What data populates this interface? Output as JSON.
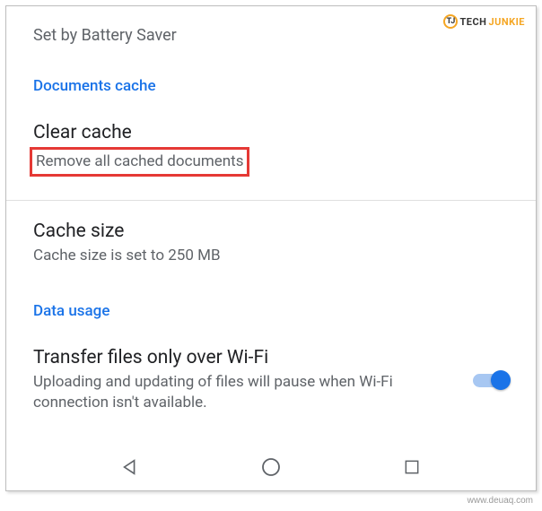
{
  "watermark": {
    "top_tech": "TECH",
    "top_junkie": "JUNKIE",
    "logo_text": "TJ",
    "bottom": "www.deuaq.com"
  },
  "battery_saver": {
    "text": "Set by Battery Saver"
  },
  "sections": {
    "documents_cache": {
      "header": "Documents cache",
      "clear_cache": {
        "title": "Clear cache",
        "subtitle": "Remove all cached documents"
      },
      "cache_size": {
        "title": "Cache size",
        "subtitle": "Cache size is set to 250 MB"
      }
    },
    "data_usage": {
      "header": "Data usage",
      "wifi_only": {
        "title": "Transfer files only over Wi-Fi",
        "subtitle": "Uploading and updating of files will pause when Wi-Fi connection isn't available.",
        "toggle_on": true
      }
    }
  }
}
